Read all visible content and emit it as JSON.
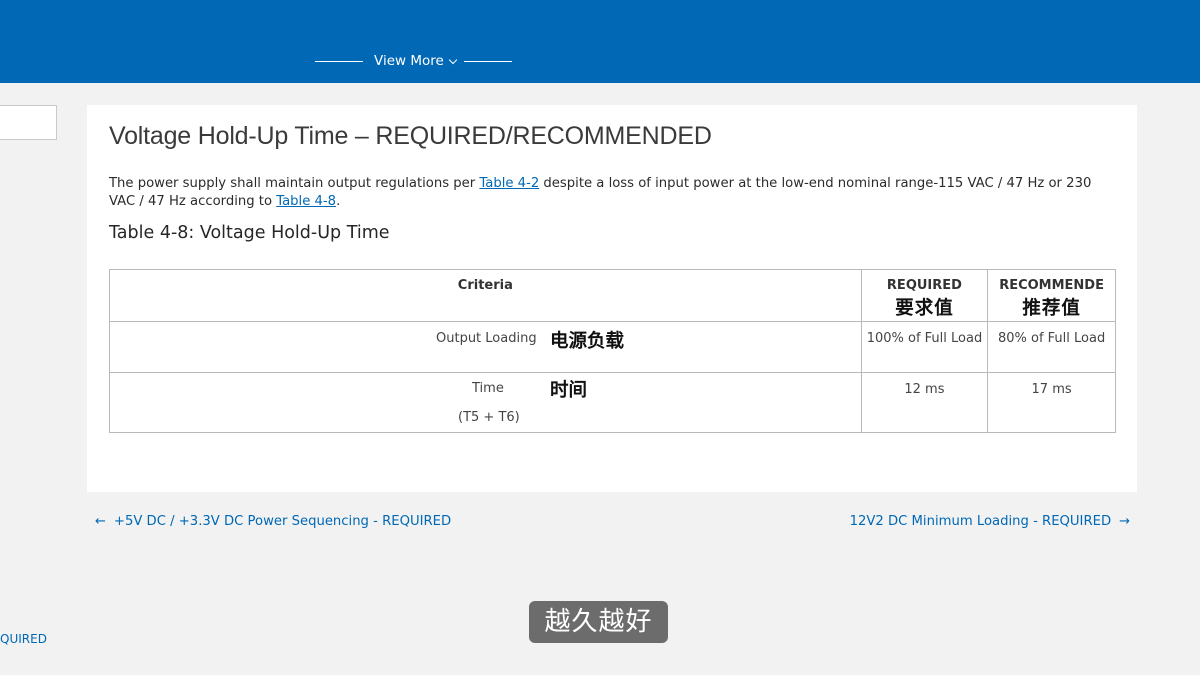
{
  "header": {
    "view_more_label": "View More"
  },
  "sidebar": {
    "partial_link": "QUIRED"
  },
  "section": {
    "title": "Voltage Hold-Up Time – REQUIRED/RECOMMENDED",
    "paragraph": {
      "text_before": "The power supply shall maintain output regulations per ",
      "link1": "Table 4-2",
      "text_middle": " despite a loss of input power at the low-end nominal range-115 VAC / 47 Hz or 230 VAC / 47 Hz according to ",
      "link2": "Table 4-8",
      "text_after": "."
    },
    "table_title": "Table 4-8: Voltage Hold-Up Time"
  },
  "table": {
    "headers": {
      "criteria": "Criteria",
      "required": "REQUIRED",
      "required_zh": "要求值",
      "recommended": "RECOMMENDE",
      "recommended_zh": "推荐值"
    },
    "rows": [
      {
        "criteria": "Output Loading",
        "criteria_zh": "电源负载",
        "required": "100% of Full Load",
        "recommended": "80% of Full Load"
      },
      {
        "criteria": "Time",
        "criteria_sub": "(T5 + T6)",
        "criteria_zh": "时间",
        "required": "12 ms",
        "recommended": "17 ms"
      }
    ]
  },
  "pager": {
    "prev_label": "+5V DC / +3.3V DC Power Sequencing - REQUIRED",
    "next_label": "12V2 DC Minimum Loading - REQUIRED"
  },
  "overlay": {
    "subtitle": "越久越好"
  },
  "colors": {
    "brand_blue": "#0068b5",
    "link": "#0068b5",
    "background": "#f2f2f2",
    "card": "#ffffff"
  }
}
